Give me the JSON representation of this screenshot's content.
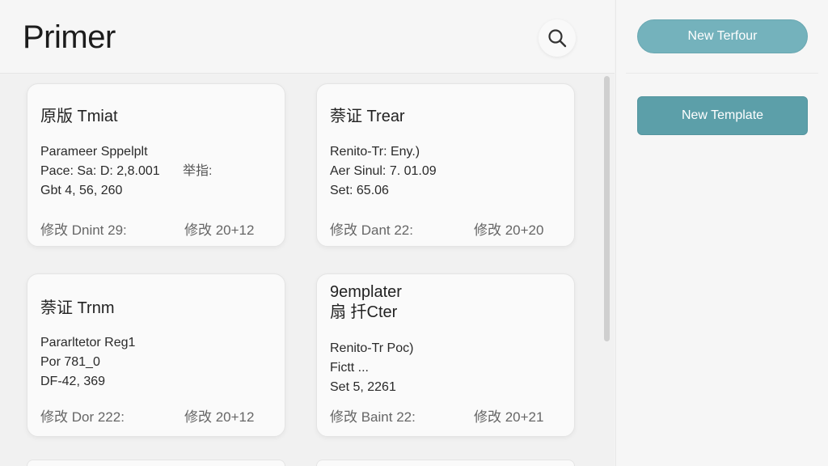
{
  "header": {
    "title": "Primer"
  },
  "side": {
    "top_button_label": "New Terfour",
    "template_button_label": "New Template"
  },
  "cards": [
    {
      "title": "原版 Tmiat",
      "lines": [
        "Parameer Sppelplt",
        "Pace: Sa: D: 2,8.001",
        "Gbt  4, 56, 260"
      ],
      "extra": "举指:",
      "foot_left": "修改 Dnint 29:",
      "foot_right": "修改 20+12"
    },
    {
      "title": "萘证 Trear",
      "lines": [
        "Renito-Tr: Eny.)",
        "Aer Sinul: 7. 01.09",
        "Set: 65.06"
      ],
      "foot_left": "修改 Dant 22:",
      "foot_right": "修改 20+20"
    },
    {
      "title": "萘证 Trnm",
      "lines": [
        "Pararltetor Reg1",
        "Por 781_0",
        "DF-42, 369"
      ],
      "foot_left": "修改 Dor 222:",
      "foot_right": "修改 20+12"
    },
    {
      "title": "9emplater\n扇 扦Cter",
      "lines": [
        "Renito-Tr Poc)",
        "Fictt  ...",
        "Set 5, 2261"
      ],
      "foot_left": "修改 Baint 22:",
      "foot_right": "修改 20+21"
    }
  ],
  "colors": {
    "accent_light": "#74b2bc",
    "accent": "#5c9fa9",
    "background": "#f1f1f1",
    "card": "#fafafa"
  },
  "icons": {
    "search": "search-icon"
  }
}
